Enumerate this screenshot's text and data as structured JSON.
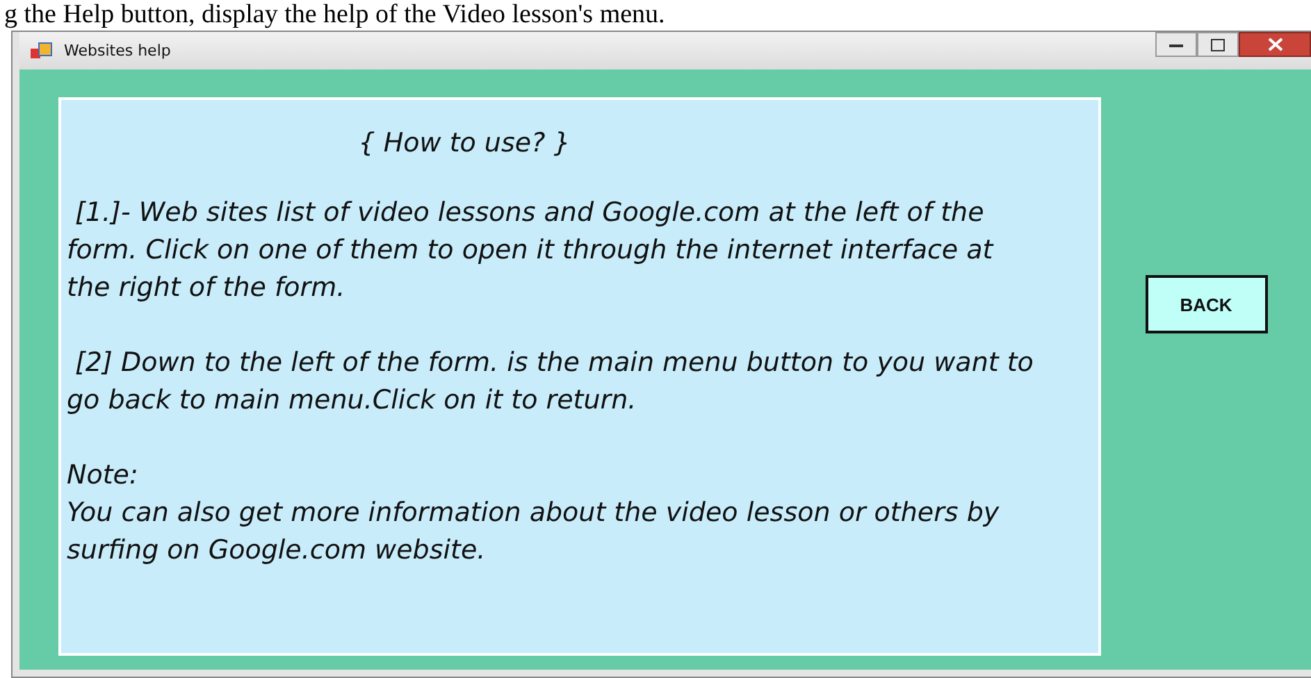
{
  "document_text": "g the Help button, display the help of the Video lesson's menu.",
  "window": {
    "title": "Websites help"
  },
  "help": {
    "heading": "{ How to use? }",
    "paragraphs": [
      {
        "kind": "item",
        "text": "[1.]- Web sites list of video lessons and Google.com at the left of the form. Click on one of them to open it through the internet interface at the right of the form."
      },
      {
        "kind": "item",
        "text": "[2]  Down to the left of the form. is the main menu button to you want to go back to main menu.Click on it to return."
      },
      {
        "kind": "note",
        "label": "Note:",
        "text": "You can also get more information about the video lesson or others by surfing on Google.com website."
      }
    ]
  },
  "buttons": [
    "BACK"
  ]
}
